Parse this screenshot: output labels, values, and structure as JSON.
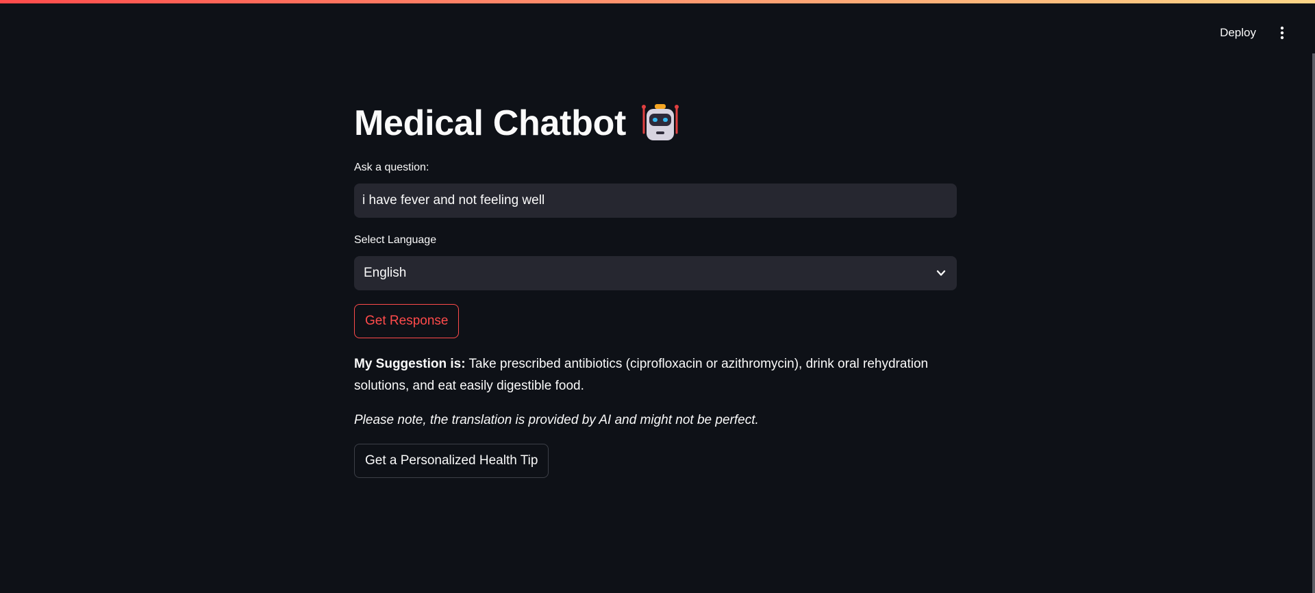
{
  "header": {
    "deploy_label": "Deploy",
    "menu_icon": "vertical-ellipsis-icon"
  },
  "main": {
    "title": "Medical Chatbot",
    "title_icon": "robot-icon",
    "question_label": "Ask a question:",
    "question_value": "i have fever and not feeling well",
    "language_label": "Select Language",
    "language_selected": "English",
    "get_response_label": "Get Response",
    "suggestion_prefix": "My Suggestion is:",
    "suggestion_text": "Take prescribed antibiotics (ciprofloxacin or azithromycin), drink oral rehydration solutions, and eat easily digestible food.",
    "translation_note": "Please note, the translation is provided by AI and might not be perfect.",
    "health_tip_label": "Get a Personalized Health Tip"
  },
  "colors": {
    "background": "#0e1117",
    "input_bg": "#262730",
    "accent": "#ff4b4b",
    "text": "#fafafa"
  }
}
